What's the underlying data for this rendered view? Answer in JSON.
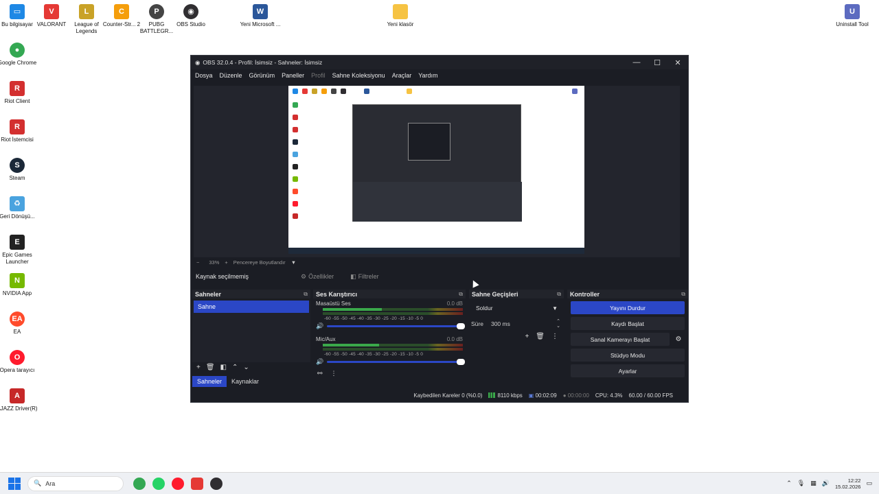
{
  "desktop": {
    "icons": [
      {
        "label": "Bu bilgisayar",
        "icon": "computer-icon",
        "color": "#1e88e5"
      },
      {
        "label": "VALORANT",
        "icon": "valorant-icon",
        "color": "#e53935"
      },
      {
        "label": "League of Legends",
        "icon": "league-icon",
        "color": "#c9a227"
      },
      {
        "label": "Counter-Str... 2",
        "icon": "cs2-icon",
        "color": "#f59e0b"
      },
      {
        "label": "PUBG BATTLEGR...",
        "icon": "pubg-icon",
        "color": "#444444"
      },
      {
        "label": "OBS Studio",
        "icon": "obs-icon",
        "color": "#302e31"
      },
      {
        "label": "Yeni Microsoft ...",
        "icon": "word-icon",
        "color": "#2b579a"
      },
      {
        "label": "Yeni klasör",
        "icon": "folder-icon",
        "color": "#f6c343"
      },
      {
        "label": "Uninstall Tool",
        "icon": "uninstall-icon",
        "color": "#5c6bc0"
      },
      {
        "label": "Google Chrome",
        "icon": "chrome-icon",
        "color": "#34a853"
      },
      {
        "label": "Riot Client",
        "icon": "riot-icon",
        "color": "#d32f2f"
      },
      {
        "label": "Riot İstemcisi",
        "icon": "riot-icon",
        "color": "#d32f2f"
      },
      {
        "label": "Steam",
        "icon": "steam-icon",
        "color": "#1b2838"
      },
      {
        "label": "Geri Dönüşü...",
        "icon": "recycle-bin-icon",
        "color": "#4aa3df"
      },
      {
        "label": "Epic Games Launcher",
        "icon": "epic-icon",
        "color": "#222222"
      },
      {
        "label": "NVIDIA App",
        "icon": "nvidia-icon",
        "color": "#76b900"
      },
      {
        "label": "EA",
        "icon": "ea-icon",
        "color": "#ff4b2b"
      },
      {
        "label": "Opera tarayıcı",
        "icon": "opera-icon",
        "color": "#ff1b2d"
      },
      {
        "label": "AJAZZ Driver(R)",
        "icon": "ajazz-icon",
        "color": "#c62828"
      }
    ]
  },
  "obs": {
    "title": "OBS 32.0.4 - Profil: İsimsiz - Sahneler: İsimsiz",
    "window_buttons": {
      "minimize": "—",
      "maximize": "☐",
      "close": "✕"
    },
    "menu": [
      {
        "label": "Dosya",
        "dim": false
      },
      {
        "label": "Düzenle",
        "dim": false
      },
      {
        "label": "Görünüm",
        "dim": false
      },
      {
        "label": "Paneller",
        "dim": false
      },
      {
        "label": "Profil",
        "dim": true
      },
      {
        "label": "Sahne Koleksiyonu",
        "dim": false
      },
      {
        "label": "Araçlar",
        "dim": false
      },
      {
        "label": "Yardım",
        "dim": false
      }
    ],
    "zoom": {
      "minus": "−",
      "value": "33%",
      "plus": "+",
      "fit": "Pencereye Boyutlandır"
    },
    "source_bar": {
      "none": "Kaynak seçilmemiş",
      "properties": "Özellikler",
      "filters": "Filtreler"
    },
    "scenes": {
      "title": "Sahneler",
      "items": [
        "Sahne"
      ],
      "tabs": {
        "scenes": "Sahneler",
        "sources": "Kaynaklar"
      }
    },
    "mixer": {
      "title": "Ses Karıştırıcı",
      "ticks": "-60 -55 -50 -45 -40 -35 -30 -25 -20 -15 -10 -5 0",
      "channels": [
        {
          "name": "Masaüstü Ses",
          "db": "0.0 dB",
          "level": 0.42
        },
        {
          "name": "Mic/Aux",
          "db": "0.0 dB",
          "level": 0.4
        }
      ]
    },
    "transitions": {
      "title": "Sahne Geçişleri",
      "selected": "Soldur",
      "duration_label": "Süre",
      "duration_value": "300 ms"
    },
    "controls": {
      "title": "Kontroller",
      "stop_stream": "Yayını Durdur",
      "start_record": "Kaydı Başlat",
      "virtual_cam": "Sanal Kamerayı Başlat",
      "studio_mode": "Stüdyo Modu",
      "settings": "Ayarlar"
    },
    "status": {
      "dropped": "Kaybedilen Kareler 0 (%0.0)",
      "bitrate": "8110 kbps",
      "stream_time": "00:02:09",
      "rec_time": "00:00:00",
      "cpu": "CPU: 4.3%",
      "fps": "60.00 / 60.00 FPS"
    }
  },
  "taskbar": {
    "search_placeholder": "Ara",
    "time": "12:22",
    "date": "15.02.2026"
  }
}
